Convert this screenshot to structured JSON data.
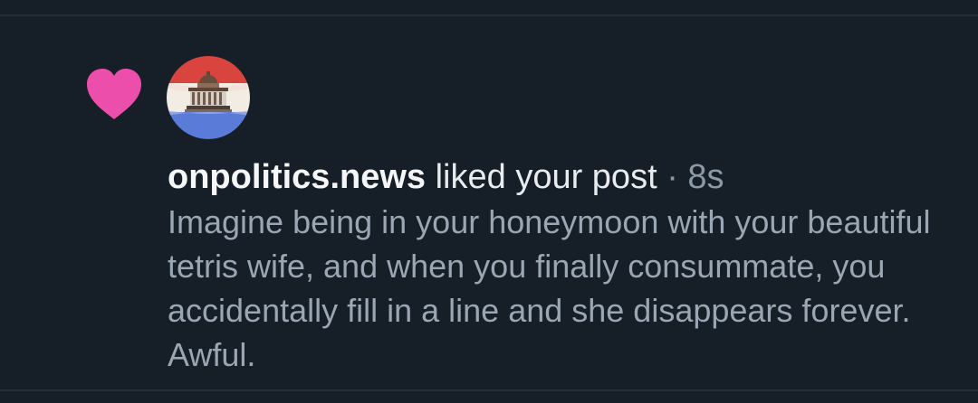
{
  "notification": {
    "author": "onpolitics.news",
    "action": "liked your post",
    "separator": "·",
    "time": "8s",
    "post_text": "Imagine being in your honeymoon with your beautiful tetris wife, and when you finally consummate, you accidentally fill in a line and she disappears forever. Awful.",
    "icon": "heart-icon",
    "avatar_icon": "capitol-building-flag-avatar"
  },
  "colors": {
    "background": "#161e27",
    "heart": "#ec4fab",
    "author_text": "#f4f6f8",
    "secondary_text": "#9aa6b3",
    "divider": "#232d38"
  }
}
